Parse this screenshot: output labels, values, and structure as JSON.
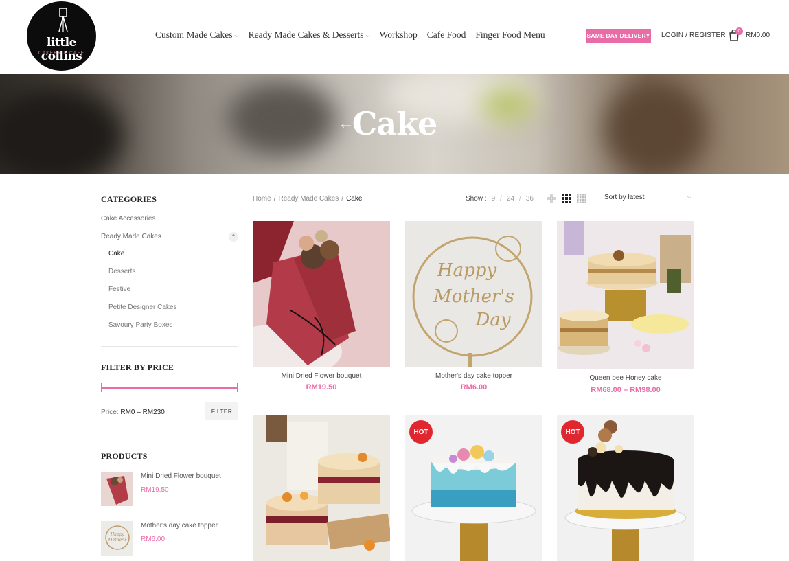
{
  "header": {
    "logo": {
      "line1": "little collins",
      "line2": "CAKERY & CAFE"
    },
    "nav": [
      {
        "label": "Custom Made Cakes",
        "has_dropdown": true
      },
      {
        "label": "Ready Made Cakes & Desserts",
        "has_dropdown": true
      },
      {
        "label": "Workshop",
        "has_dropdown": false
      },
      {
        "label": "Cafe Food",
        "has_dropdown": false
      },
      {
        "label": "Finger Food Menu",
        "has_dropdown": false
      }
    ],
    "same_day_delivery": "SAME DAY DELIVERY",
    "login_register": "LOGIN / REGISTER",
    "cart": {
      "count": "0",
      "total": "RM0.00",
      "icon": "shopping-bag-icon"
    }
  },
  "banner": {
    "title": "Cake",
    "back_arrow": "←"
  },
  "breadcrumb": [
    "Home",
    "Ready Made Cakes",
    "Cake"
  ],
  "toolbar": {
    "show_label": "Show :",
    "show_options": [
      "9",
      "24",
      "36"
    ],
    "sort_label": "Sort by latest"
  },
  "sidebar": {
    "categories_title": "CATEGORIES",
    "categories": [
      "Cake Accessories",
      "Ready Made Cakes"
    ],
    "subcategories": [
      "Cake",
      "Desserts",
      "Festive",
      "Petite Designer Cakes",
      "Savoury Party Boxes"
    ],
    "filter_title": "FILTER BY PRICE",
    "price_prefix": "Price:",
    "price_range": "RM0 – RM230",
    "filter_button": "FILTER",
    "products_title": "PRODUCTS",
    "products": [
      {
        "name": "Mini Dried Flower bouquet",
        "price": "RM19.50"
      },
      {
        "name": "Mother's day cake topper",
        "price": "RM6.00"
      }
    ]
  },
  "products": [
    {
      "name": "Mini Dried Flower bouquet",
      "price": "RM19.50",
      "hot": false
    },
    {
      "name": "Mother's day cake topper",
      "price": "RM6.00",
      "hot": false
    },
    {
      "name": "Queen bee Honey cake",
      "price": "RM68.00 – RM98.00",
      "hot": false
    },
    {
      "name": "",
      "price": "",
      "hot": false
    },
    {
      "name": "",
      "price": "",
      "hot": true,
      "badge": "HOT"
    },
    {
      "name": "",
      "price": "",
      "hot": true,
      "badge": "HOT"
    }
  ],
  "topper_text": [
    "Happy",
    "Mother's",
    "Day"
  ],
  "colors": {
    "accent_pink": "#ea6ca6",
    "hot_red": "#e0272f",
    "text_dark": "#222222"
  }
}
